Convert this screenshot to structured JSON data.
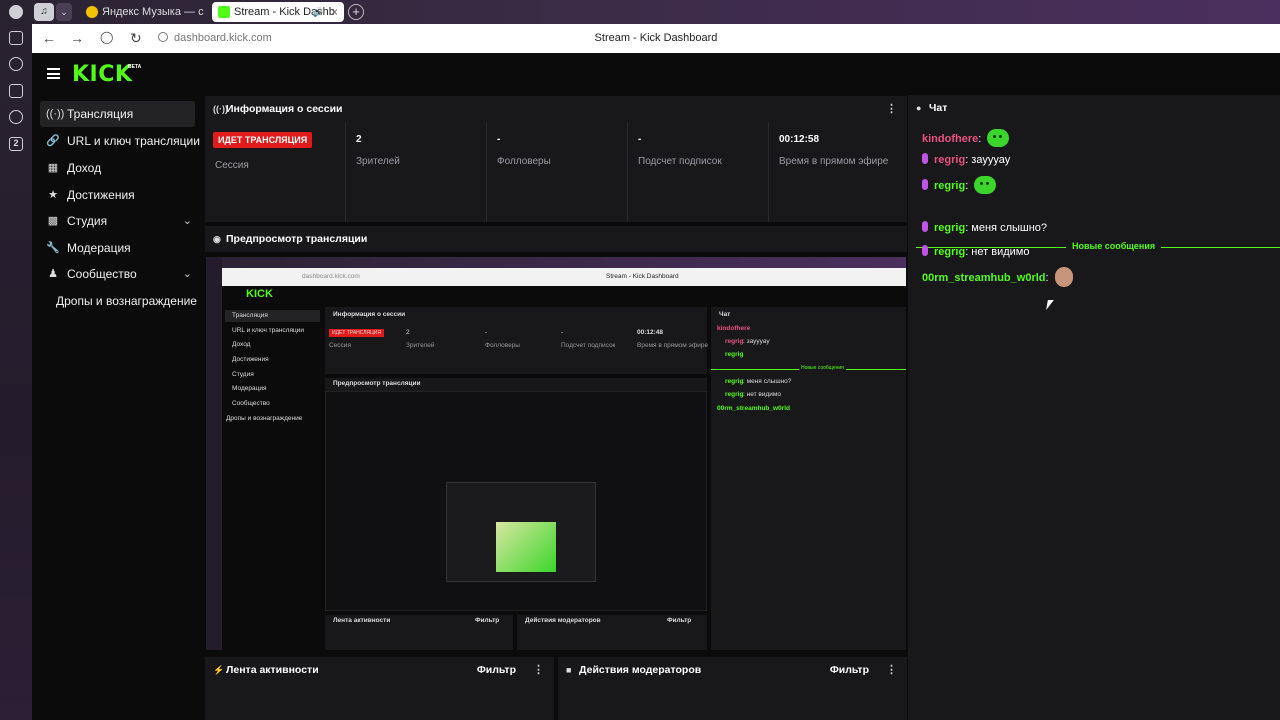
{
  "browser": {
    "tabs": [
      {
        "label": "Яндекс Музыка — с"
      },
      {
        "label": "Stream - Kick Dashb"
      }
    ],
    "url": "dashboard.kick.com",
    "page_title": "Stream - Kick Dashboard",
    "os_badge": "2"
  },
  "app": {
    "logo": "KICK",
    "logo_badge": "BETA",
    "brand_color": "#53fc18",
    "sidebar": [
      {
        "label": "Трансляция",
        "icon": "broadcast-icon"
      },
      {
        "label": "URL и ключ трансляции",
        "icon": "link-icon"
      },
      {
        "label": "Доход",
        "icon": "chart-icon"
      },
      {
        "label": "Достижения",
        "icon": "trophy-icon"
      },
      {
        "label": "Студия",
        "icon": "studio-icon"
      },
      {
        "label": "Модерация",
        "icon": "wrench-icon"
      },
      {
        "label": "Сообщество",
        "icon": "users-icon"
      },
      {
        "label": "Дропы и вознаграждение",
        "icon": ""
      }
    ]
  },
  "session": {
    "title": "Информация о сессии",
    "badge": "ИДЕТ ТРАНСЛЯЦИЯ",
    "badge_label": "Сессия",
    "stats": [
      {
        "value": "2",
        "label": "Зрителей"
      },
      {
        "value": "-",
        "label": "Фолловеры"
      },
      {
        "value": "-",
        "label": "Подсчет подписок"
      },
      {
        "value": "00:12:58",
        "label": "Время в прямом эфире"
      }
    ]
  },
  "preview": {
    "title": "Предпросмотр трансляции",
    "inner": {
      "page_title": "Stream - Kick Dashboard",
      "url": "dashboard.kick.com",
      "session_title": "Информация о сессии",
      "badge": "ИДЕТ ТРАНСЛЯЦИЯ",
      "badge_label": "Сессия",
      "time": "00:12:48",
      "preview_title": "Предпросмотр трансляции",
      "chat_title": "Чат",
      "activity": "Лента активности",
      "moderators": "Действия модераторов",
      "filter": "Фильтр"
    }
  },
  "activity": {
    "title": "Лента активности",
    "filter": "Фильтр"
  },
  "moderation": {
    "title": "Действия модераторов",
    "filter": "Фильтр"
  },
  "chat": {
    "title": "Чат",
    "messages": [
      {
        "user": "kindofhere",
        "text": "",
        "color": "#e9527f",
        "mic": false,
        "emote": "green-blob-emote"
      },
      {
        "user": "regrig",
        "text": ": зауууау",
        "color": "#e9527f",
        "mic": true,
        "emote": ""
      },
      {
        "user": "regrig",
        "text": ":",
        "color": "#53fc18",
        "mic": true,
        "emote": "green-blob-emote"
      },
      {
        "user": "regrig",
        "text": ": меня слышно?",
        "color": "#53fc18",
        "mic": true,
        "emote": ""
      },
      {
        "user": "regrig",
        "text": ": нет видимо",
        "color": "#53fc18",
        "mic": true,
        "emote": ""
      },
      {
        "user": "00rm_streamhub_w0rld",
        "text": ":",
        "color": "#53fc18",
        "mic": false,
        "emote": "face-emote"
      }
    ],
    "new_messages": "Новые сообщения"
  }
}
